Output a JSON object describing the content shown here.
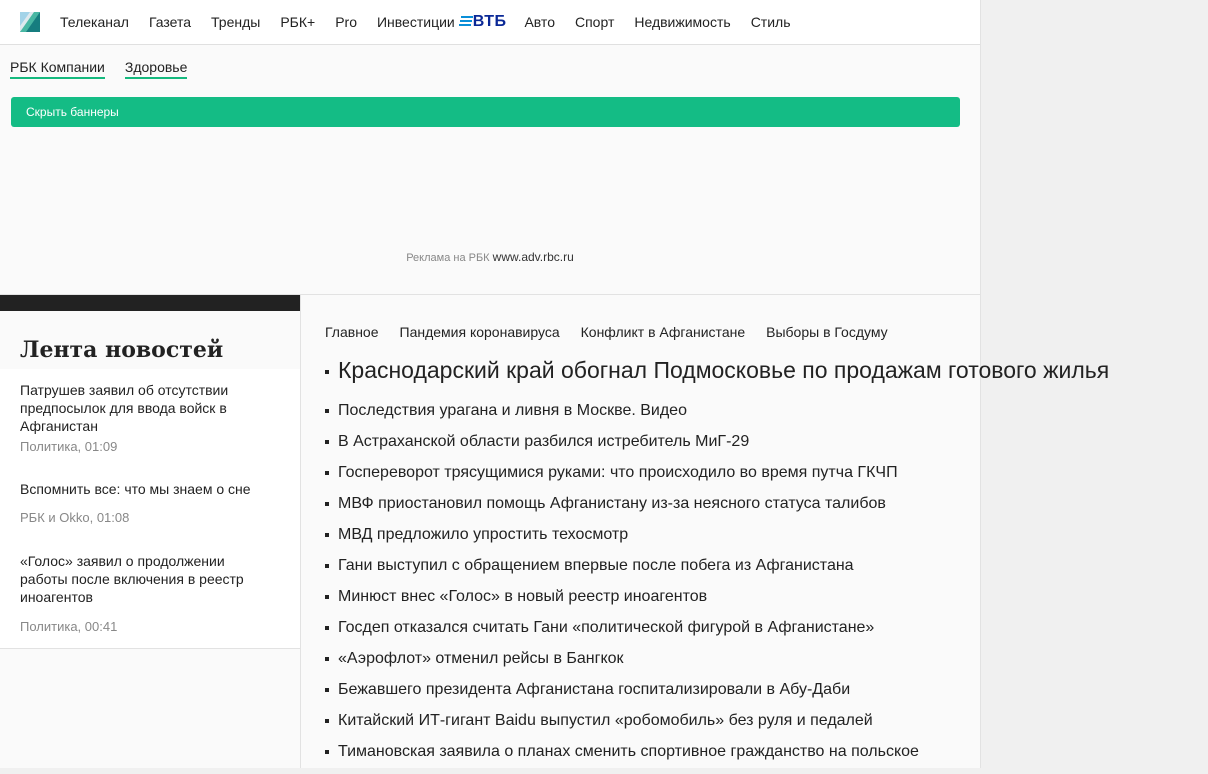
{
  "top_nav": {
    "items": [
      "Телеканал",
      "Газета",
      "Тренды",
      "РБК+",
      "Pro",
      "Инвестиции",
      "Авто",
      "Спорт",
      "Недвижимость",
      "Стиль"
    ],
    "vtb_logo": "ВТБ"
  },
  "sub_nav": {
    "items": [
      "РБК Компании",
      "Здоровье"
    ]
  },
  "hide_banners": "Скрыть баннеры",
  "ad": {
    "label": "Реклама на РБК",
    "link": "www.adv.rbc.ru"
  },
  "feed": {
    "title": "Лента новостей",
    "items": [
      {
        "title": "Патрушев заявил об отсутствии предпосылок для ввода войск в Афганистан",
        "meta": "Политика, 01:09"
      },
      {
        "title": "Вспомнить все: что мы знаем о сне",
        "meta": "РБК и Okko, 01:08"
      },
      {
        "title": "«Голос» заявил о продолжении работы после включения в реестр иноагентов",
        "meta": "Политика, 00:41"
      }
    ]
  },
  "tabs": [
    "Главное",
    "Пандемия коронавируса",
    "Конфликт в Афганистане",
    "Выборы в Госдуму"
  ],
  "lead_news": "Краснодарский край обогнал Подмосковье по продажам готового жилья",
  "news": [
    "Последствия урагана и ливня в Москве. Видео",
    "В Астраханской области разбился истребитель МиГ-29",
    "Госпереворот трясущимися руками: что происходило во время путча ГКЧП",
    "МВФ приостановил помощь Афганистану из-за неясного статуса талибов",
    "МВД предложило упростить техосмотр",
    "Гани выступил с обращением впервые после побега из Афганистана",
    "Минюст внес «Голос» в новый реестр иноагентов",
    "Госдеп отказался считать Гани «политической фигурой в Афганистане»",
    "«Аэрофлот» отменил рейсы в Бангкок",
    "Бежавшего президента Афганистана госпитализировали в Абу-Даби",
    "Китайский ИТ-гигант Baidu выпустил «робомобиль» без руля и педалей",
    "Тимановская заявила о планах сменить спортивное гражданство на польское"
  ],
  "colors": {
    "accent": "#14bc85",
    "vtb": "#0a2896"
  }
}
